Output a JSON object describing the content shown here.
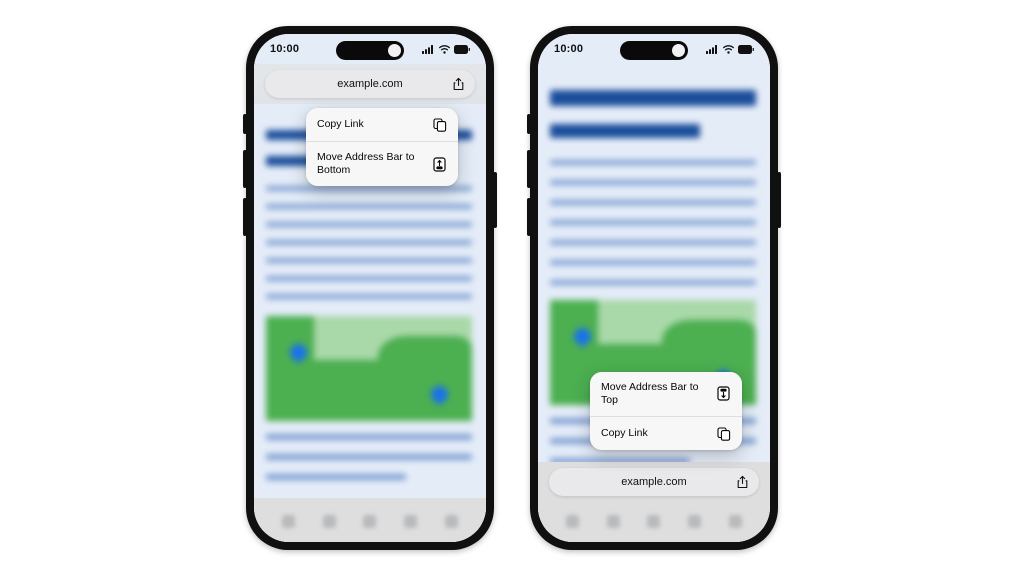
{
  "scene": {
    "description": "Two iPhone mockups showing Safari context menu options for moving the address bar",
    "background_color": "#ffffff"
  },
  "phones": [
    {
      "id": "phone-left",
      "status_bar": {
        "time": "10:00",
        "icons": [
          "cellular-signal-icon",
          "wifi-icon",
          "battery-icon"
        ]
      },
      "address_bar": {
        "position": "top",
        "url": "example.com",
        "share_icon": "share-icon"
      },
      "context_menu": {
        "position": "top",
        "items": [
          {
            "label": "Copy Link",
            "icon": "copy-link-icon"
          },
          {
            "label": "Move Address Bar to Bottom",
            "icon": "address-bar-bottom-icon"
          }
        ]
      },
      "toolbar": {
        "icons": [
          "back-icon",
          "forward-icon",
          "share-icon",
          "bookmarks-icon",
          "tabs-icon"
        ]
      },
      "page": {
        "map_pins": 2,
        "map_colors": {
          "land": "#4caf50",
          "base": "#a9d8a9"
        },
        "text_color": "#7e9ed1",
        "heading_color": "#1b4e9b"
      }
    },
    {
      "id": "phone-right",
      "status_bar": {
        "time": "10:00",
        "icons": [
          "cellular-signal-icon",
          "wifi-icon",
          "battery-icon"
        ]
      },
      "address_bar": {
        "position": "bottom",
        "url": "example.com",
        "share_icon": "share-icon"
      },
      "context_menu": {
        "position": "bottom",
        "items": [
          {
            "label": "Move Address Bar to Top",
            "icon": "address-bar-top-icon"
          },
          {
            "label": "Copy Link",
            "icon": "copy-link-icon"
          }
        ]
      },
      "toolbar": {
        "icons": [
          "back-icon",
          "forward-icon",
          "share-icon",
          "bookmarks-icon",
          "tabs-icon"
        ]
      },
      "page": {
        "map_pins": 2,
        "map_colors": {
          "land": "#4caf50",
          "base": "#a9d8a9"
        },
        "text_color": "#7e9ed1",
        "heading_color": "#1b4e9b"
      }
    }
  ]
}
